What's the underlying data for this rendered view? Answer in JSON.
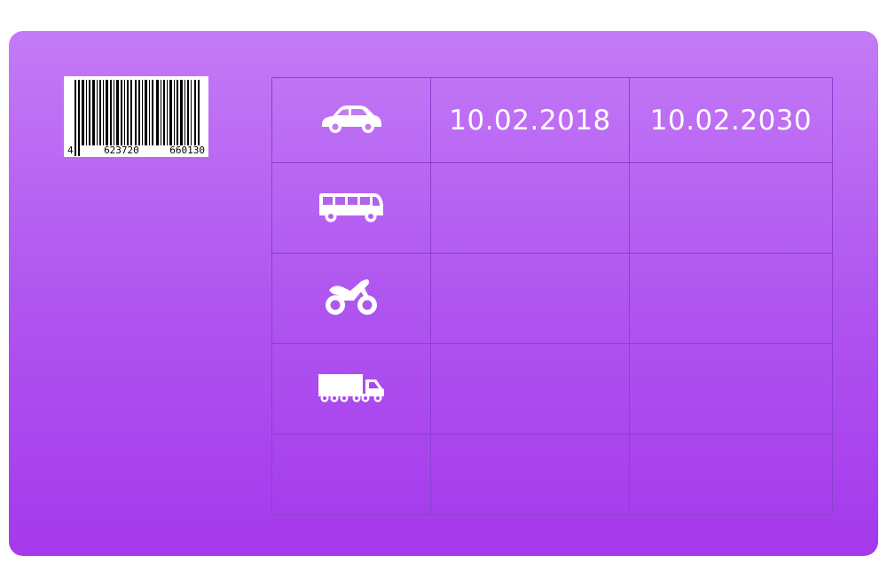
{
  "card": {
    "background_top": "#c47bf6",
    "background_bottom": "#a539ec",
    "grid_line_color": "#8d3fd1"
  },
  "barcode": {
    "digits": [
      "4",
      "623720",
      "660130"
    ]
  },
  "categories": [
    {
      "icon": "car-icon",
      "from": "10.02.2018",
      "to": "10.02.2030"
    },
    {
      "icon": "bus-icon",
      "from": "",
      "to": ""
    },
    {
      "icon": "motorcycle-icon",
      "from": "",
      "to": ""
    },
    {
      "icon": "truck-trailer-icon",
      "from": "",
      "to": ""
    },
    {
      "icon": "",
      "from": "",
      "to": ""
    }
  ]
}
